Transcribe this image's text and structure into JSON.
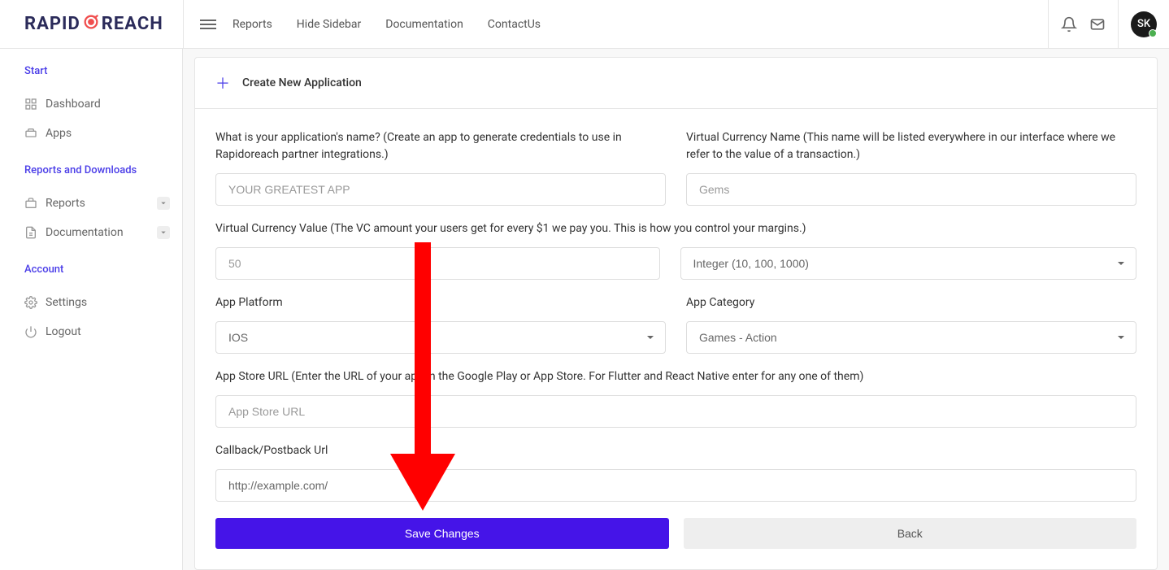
{
  "brand": {
    "part1": "RAPID",
    "part2": "REACH"
  },
  "header": {
    "nav": [
      "Reports",
      "Hide Sidebar",
      "Documentation",
      "ContactUs"
    ],
    "avatar_initials": "SK"
  },
  "sidebar": {
    "sections": [
      {
        "heading": "Start",
        "items": [
          {
            "label": "Dashboard",
            "icon": "dashboard-icon",
            "expandable": false
          },
          {
            "label": "Apps",
            "icon": "apps-icon",
            "expandable": false
          }
        ]
      },
      {
        "heading": "Reports and Downloads",
        "items": [
          {
            "label": "Reports",
            "icon": "briefcase-icon",
            "expandable": true
          },
          {
            "label": "Documentation",
            "icon": "document-icon",
            "expandable": true
          }
        ]
      },
      {
        "heading": "Account",
        "items": [
          {
            "label": "Settings",
            "icon": "gear-icon",
            "expandable": false
          },
          {
            "label": "Logout",
            "icon": "power-icon",
            "expandable": false
          }
        ]
      }
    ]
  },
  "panel": {
    "title": "Create New Application"
  },
  "form": {
    "app_name": {
      "label": "What is your application's name? (Create an app to generate credentials to use in Rapidoreach partner integrations.)",
      "placeholder": "YOUR GREATEST APP",
      "value": ""
    },
    "vc_name": {
      "label": "Virtual Currency Name (This name will be listed everywhere in our interface where we refer to the value of a transaction.)",
      "placeholder": "Gems",
      "value": ""
    },
    "vc_value": {
      "label": "Virtual Currency Value (The VC amount your users get for every $1 we pay you. This is how you control your margins.)",
      "placeholder": "50",
      "value": ""
    },
    "vc_type": {
      "selected": "Integer (10, 100, 1000)"
    },
    "platform": {
      "label": "App Platform",
      "selected": "IOS"
    },
    "category": {
      "label": "App Category",
      "selected": "Games - Action"
    },
    "store_url": {
      "label": "App Store URL (Enter the URL of your app in the Google Play or App Store. For Flutter and React Native enter for any one of them)",
      "placeholder": "App Store URL",
      "value": ""
    },
    "callback_url": {
      "label": "Callback/Postback Url",
      "placeholder": "",
      "value": "http://example.com/"
    }
  },
  "buttons": {
    "save": "Save Changes",
    "back": "Back"
  }
}
